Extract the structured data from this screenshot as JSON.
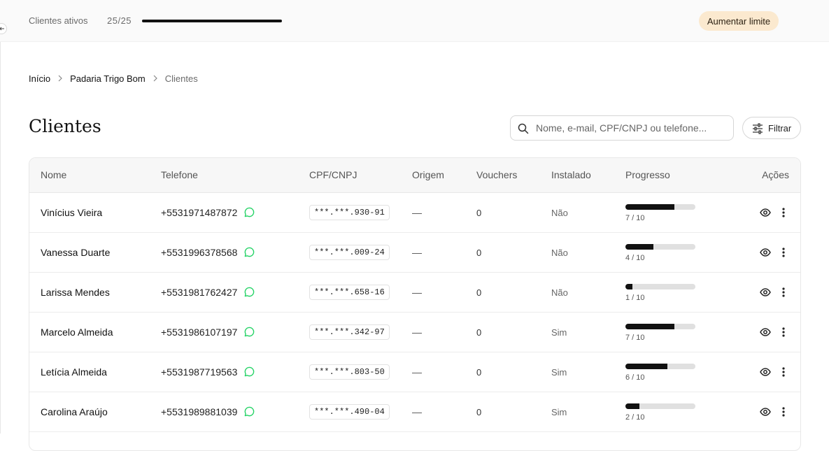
{
  "topbar": {
    "active_clients_label": "Clientes ativos",
    "active_clients_count": "25/25",
    "limit_used_fraction": 1.0,
    "upgrade_label": "Aumentar limite",
    "upgrade_color": "#fbe9cf"
  },
  "breadcrumb": {
    "items": [
      "Início",
      "Padaria Trigo Bom",
      "Clientes"
    ],
    "separator_icon": "chevron-right-icon"
  },
  "page": {
    "title": "Clientes"
  },
  "search": {
    "placeholder": "Nome, e-mail, CPF/CNPJ ou telefone...",
    "value": "",
    "icon": "search-icon"
  },
  "filter": {
    "label": "Filtrar",
    "icon": "sliders-icon"
  },
  "table": {
    "headers": {
      "name": "Nome",
      "phone": "Telefone",
      "doc": "CPF/CNPJ",
      "origin": "Origem",
      "vouchers": "Vouchers",
      "installed": "Instalado",
      "progress": "Progresso",
      "actions": "Ações"
    },
    "row_icons": {
      "whatsapp": "whatsapp-icon",
      "view": "eye-icon",
      "more": "more-vertical-icon"
    },
    "whatsapp_color": "#25d366",
    "rows": [
      {
        "name": "Vinícius Vieira",
        "phone": "+5531971487872",
        "doc": "***.***.930-91",
        "origin": "—",
        "vouchers": "0",
        "installed": "Não",
        "progress": 7,
        "progress_text": "7 / 10"
      },
      {
        "name": "Vanessa Duarte",
        "phone": "+5531996378568",
        "doc": "***.***.009-24",
        "origin": "—",
        "vouchers": "0",
        "installed": "Não",
        "progress": 4,
        "progress_text": "4 / 10"
      },
      {
        "name": "Larissa Mendes",
        "phone": "+5531981762427",
        "doc": "***.***.658-16",
        "origin": "—",
        "vouchers": "0",
        "installed": "Não",
        "progress": 1,
        "progress_text": "1 / 10"
      },
      {
        "name": "Marcelo Almeida",
        "phone": "+5531986107197",
        "doc": "***.***.342-97",
        "origin": "—",
        "vouchers": "0",
        "installed": "Sim",
        "progress": 7,
        "progress_text": "7 / 10"
      },
      {
        "name": "Letícia Almeida",
        "phone": "+5531987719563",
        "doc": "***.***.803-50",
        "origin": "—",
        "vouchers": "0",
        "installed": "Sim",
        "progress": 6,
        "progress_text": "6 / 10"
      },
      {
        "name": "Carolina Araújo",
        "phone": "+5531989881039",
        "doc": "***.***.490-04",
        "origin": "—",
        "vouchers": "0",
        "installed": "Sim",
        "progress": 2,
        "progress_text": "2 / 10"
      }
    ]
  }
}
